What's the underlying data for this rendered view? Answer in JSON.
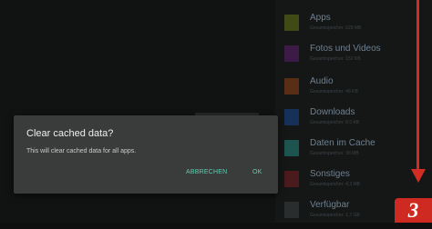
{
  "storage": {
    "categories": [
      {
        "name": "Apps",
        "size": "Gesamtspeicher: 629 MB",
        "color": "#3f4a17",
        "icon": "apps-icon"
      },
      {
        "name": "Fotos und Videos",
        "size": "Gesamtspeicher: 152 KB",
        "color": "#3c1c47",
        "icon": "photos-videos-icon"
      },
      {
        "name": "Audio",
        "size": "Gesamtspeicher: 48 KB",
        "color": "#5a2e14",
        "icon": "audio-icon"
      },
      {
        "name": "Downloads",
        "size": "Gesamtspeicher: 8,0 KB",
        "color": "#16305a",
        "icon": "downloads-icon"
      },
      {
        "name": "Daten im Cache",
        "size": "Gesamtspeicher: 38 MB",
        "color": "#1d5450",
        "icon": "cache-icon"
      },
      {
        "name": "Sonstiges",
        "size": "Gesamtspeicher: 4,3 MB",
        "color": "#4a1a1c",
        "icon": "misc-icon"
      },
      {
        "name": "Verfügbar",
        "size": "Gesamtspeicher: 1,7 GB",
        "color": "#2a2d2e",
        "icon": "available-icon"
      }
    ]
  },
  "dialog": {
    "title": "Clear cached data?",
    "message": "This will clear cached data for all apps.",
    "cancel_label": "ABBRECHEN",
    "ok_label": "OK",
    "accent_color": "#5fcfb2"
  },
  "annotation": {
    "step_number": "3",
    "color": "#d12d24"
  }
}
